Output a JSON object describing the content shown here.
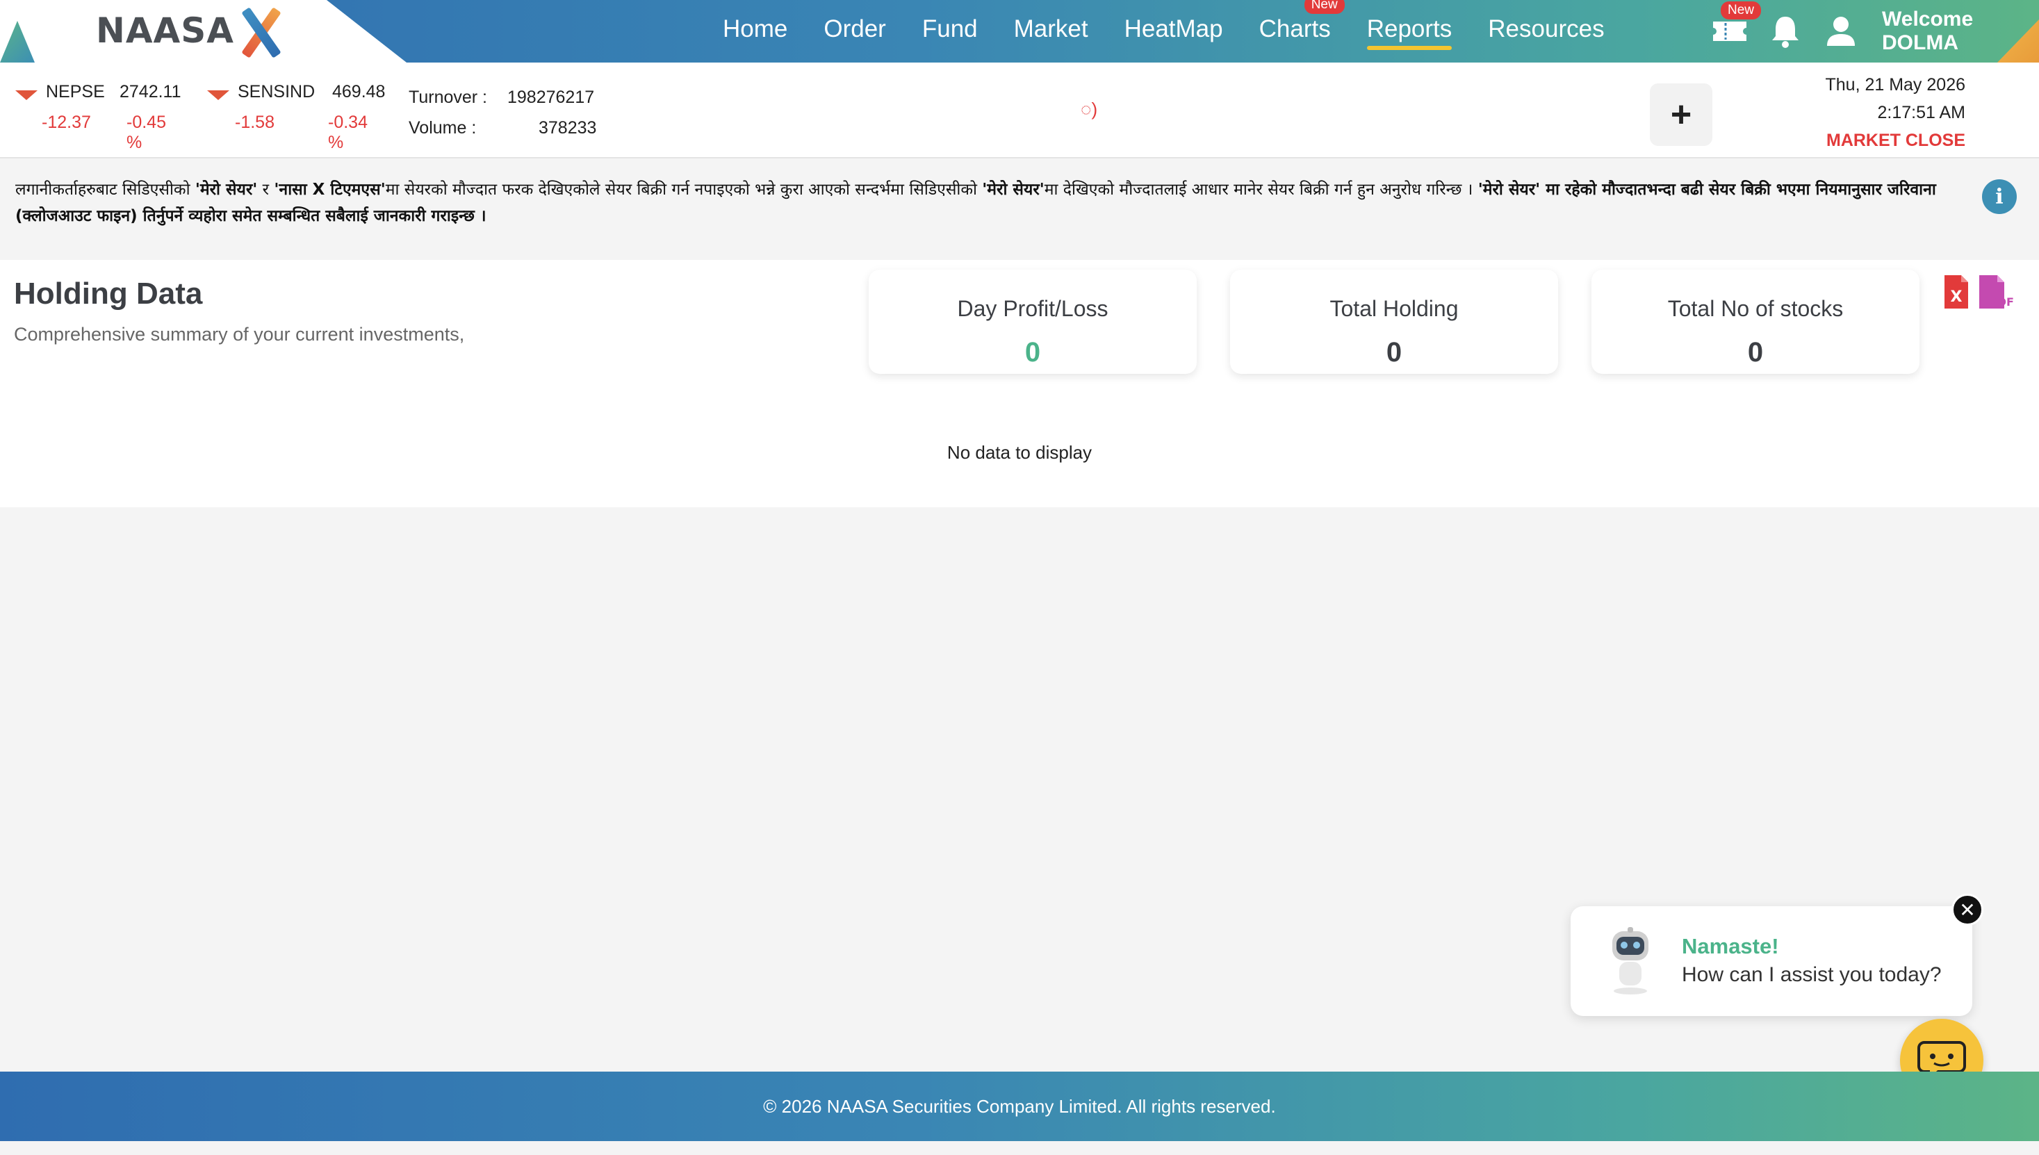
{
  "brand": {
    "logo_text": "NAASA"
  },
  "nav": {
    "items": [
      {
        "label": "Home",
        "badge": ""
      },
      {
        "label": "Order",
        "badge": ""
      },
      {
        "label": "Fund",
        "badge": ""
      },
      {
        "label": "Market",
        "badge": ""
      },
      {
        "label": "HeatMap",
        "badge": ""
      },
      {
        "label": "Charts",
        "badge": "New"
      },
      {
        "label": "Reports",
        "badge": ""
      },
      {
        "label": "Resources",
        "badge": ""
      }
    ],
    "active": "Reports",
    "ticket_badge": "New",
    "welcome_line1": "Welcome",
    "welcome_line2": "DOLMA"
  },
  "ticker": {
    "nepse": {
      "name": "NEPSE",
      "value": "2742.11",
      "change": "-12.37",
      "percent": "-0.45 %"
    },
    "sensind": {
      "name": "SENSIND",
      "value": "469.48",
      "change": "-1.58",
      "percent": "-0.34 %"
    },
    "turnover_label": "Turnover :",
    "turnover_value": "198276217",
    "volume_label": "Volume :",
    "volume_value": "378233",
    "loader_text": "◌)",
    "plus_label": "+",
    "date": "Thu, 21 May 2026",
    "time": "2:17:51 AM",
    "market_status": "MARKET CLOSE"
  },
  "notice": {
    "p1": "लगानीकर्ताहरुबाट सिडिएसीको ",
    "b1": "'मेरो सेयर'",
    "p2": " र ",
    "b2": "'नासा X टिएमएस'",
    "p3": "मा सेयरको मौज्दात फरक देखिएकोले सेयर बिक्री गर्न नपाइएको भन्ने कुरा आएको सन्दर्भमा सिडिएसीको ",
    "b3": "'मेरो सेयर'",
    "p4": "मा देखिएको मौज्दातलाई आधार मानेर सेयर बिक्री गर्न हुन अनुरोध गरिन्छ । ",
    "b4": "'मेरो सेयर' मा रहेको मौज्दातभन्दा बढी सेयर बिक्री भएमा नियमानुसार जरिवाना (क्लोजआउट फाइन) तिर्नुपर्ने व्यहोरा समेत सम्बन्धित सबैलाई जानकारी गराइन्छ ।"
  },
  "holding": {
    "title": "Holding Data",
    "subtitle": "Comprehensive summary of your current investments,",
    "cards": [
      {
        "label": "Day Profit/Loss",
        "value": "0"
      },
      {
        "label": "Total Holding",
        "value": "0"
      },
      {
        "label": "Total No of stocks",
        "value": "0"
      }
    ],
    "empty_text": "No data to display"
  },
  "chat": {
    "greeting": "Namaste!",
    "message": "How can I assist you today?"
  },
  "footer": {
    "text": "© 2026 NAASA Securities Company Limited. All rights reserved."
  },
  "colors": {
    "accent_green": "#4bb38a",
    "negative_red": "#e23a3a",
    "active_underline": "#f4c531",
    "chat_fab": "#f6c33b"
  }
}
